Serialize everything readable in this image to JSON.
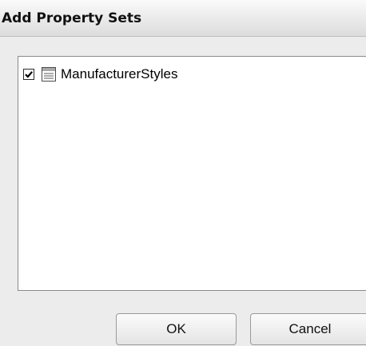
{
  "dialog": {
    "title": "Add Property Sets"
  },
  "list": {
    "items": [
      {
        "label": "ManufacturerStyles",
        "checked": true,
        "icon": "document-list-icon"
      }
    ]
  },
  "buttons": {
    "ok_label": "OK",
    "cancel_label": "Cancel"
  }
}
